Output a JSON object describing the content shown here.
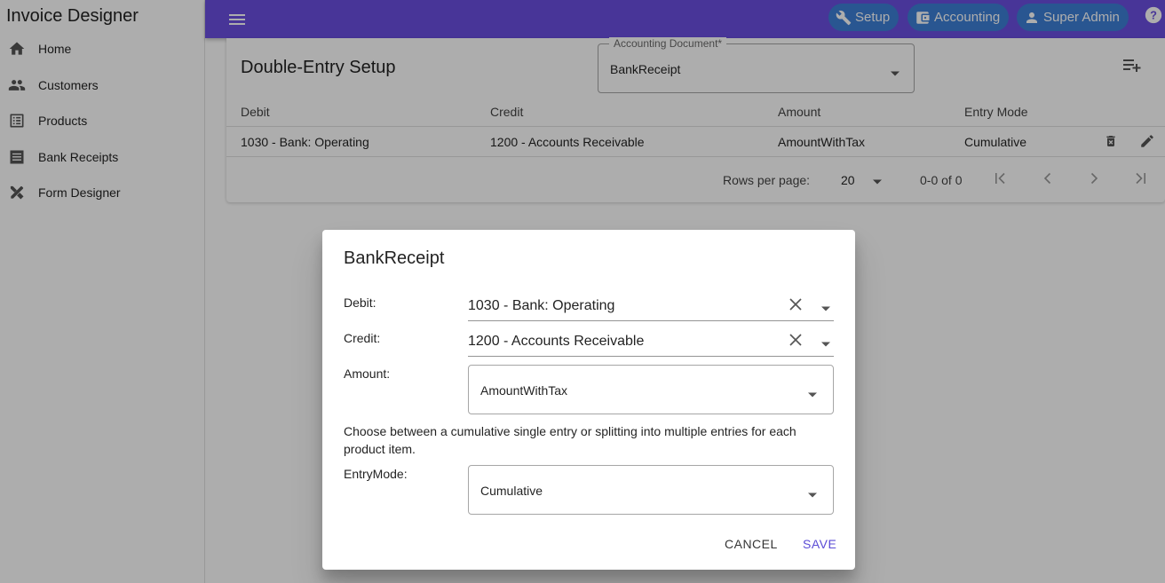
{
  "app": {
    "title": "Invoice Designer"
  },
  "sidebar": {
    "items": [
      {
        "label": "Home",
        "icon": "home-icon"
      },
      {
        "label": "Customers",
        "icon": "people-icon"
      },
      {
        "label": "Products",
        "icon": "list-icon"
      },
      {
        "label": "Bank Receipts",
        "icon": "receipt-list-icon"
      },
      {
        "label": "Form Designer",
        "icon": "design-tools-icon"
      }
    ]
  },
  "topbar": {
    "setup_label": "Setup",
    "accounting_label": "Accounting",
    "user_label": "Super Admin",
    "accent_color": "#6a4ee0",
    "chip_color": "#3d7fd6"
  },
  "page": {
    "title": "Double-Entry Setup",
    "document_select": {
      "legend": "Accounting Document*",
      "value": "BankReceipt"
    },
    "table": {
      "headers": [
        "Debit",
        "Credit",
        "Amount",
        "Entry Mode"
      ],
      "rows": [
        [
          "1030 - Bank: Operating",
          "1200 - Accounts Receivable",
          "AmountWithTax",
          "Cumulative"
        ]
      ]
    },
    "pager": {
      "rows_per_page_label": "Rows per page:",
      "rows_per_page": "20",
      "range": "0-0 of 0"
    }
  },
  "dialog": {
    "title": "BankReceipt",
    "debit_label": "Debit:",
    "debit_value": "1030 - Bank: Operating",
    "credit_label": "Credit:",
    "credit_value": "1200 - Accounts Receivable",
    "amount_label": "Amount:",
    "amount_value": "AmountWithTax",
    "help_text": "Choose between a cumulative single entry or splitting into multiple entries for each product item.",
    "entry_mode_label": "EntryMode:",
    "entry_mode_value": "Cumulative",
    "cancel_label": "CANCEL",
    "save_label": "SAVE",
    "save_color": "#5b4cd6"
  }
}
